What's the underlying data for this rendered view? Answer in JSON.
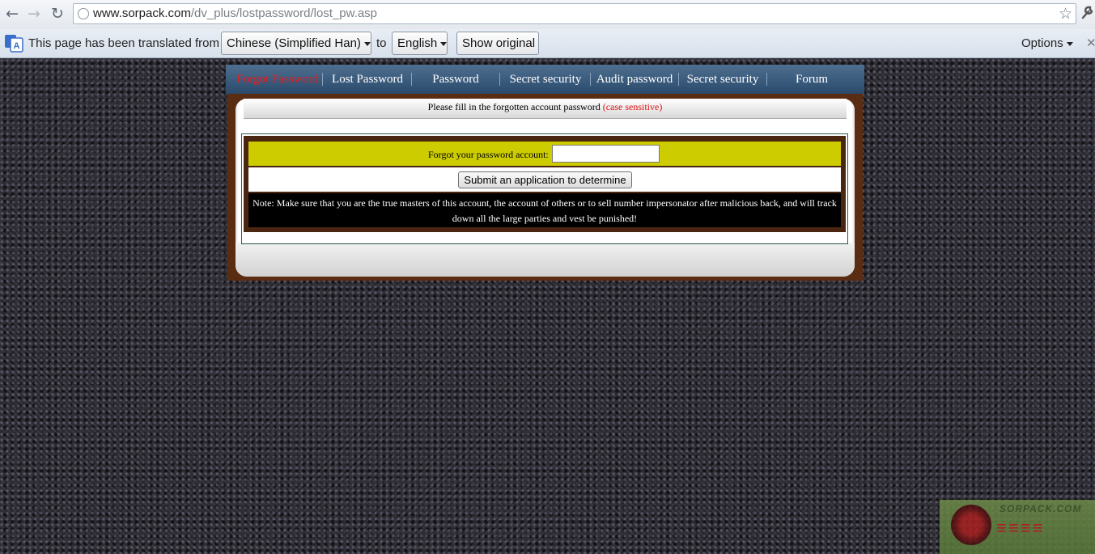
{
  "browser": {
    "url_host": "www.sorpack.com",
    "url_path": "/dv_plus/lostpassword/lost_pw.asp",
    "back_icon": "←",
    "forward_icon": "→",
    "reload_icon": "↻",
    "star_icon": "☆",
    "wrench_icon": "🔧"
  },
  "translate_bar": {
    "prefix": "This page has been translated from",
    "from_language": "Chinese (Simplified Han)",
    "to_label": "to",
    "to_language": "English",
    "show_original": "Show original",
    "options": "Options",
    "close": "✕"
  },
  "site_nav": {
    "items": [
      {
        "label": "Forgot Password",
        "active": true
      },
      {
        "label": "Lost Password"
      },
      {
        "label": "Password"
      },
      {
        "label": "Secret security"
      },
      {
        "label": "Audit password"
      },
      {
        "label": "Secret security"
      },
      {
        "label": "Forum"
      }
    ],
    "active_color": "#ea1b1b"
  },
  "form": {
    "header_text": "Please fill in the forgotten account password",
    "header_note": "(case sensitive)",
    "account_label": "Forgot your password account:",
    "account_value": "",
    "submit_label": "Submit an application to determine",
    "note": "Note: Make sure that you are the true masters of this account, the account of others or to sell number impersonator after malicious back, and will track down all the large parties and vest be punished!"
  },
  "watermark": {
    "line1": "SORPACK.COM"
  },
  "colors": {
    "row_yellow": "#cccc00",
    "frame_brown": "#5a2c12",
    "nav_blue": "#3c5c7e"
  }
}
